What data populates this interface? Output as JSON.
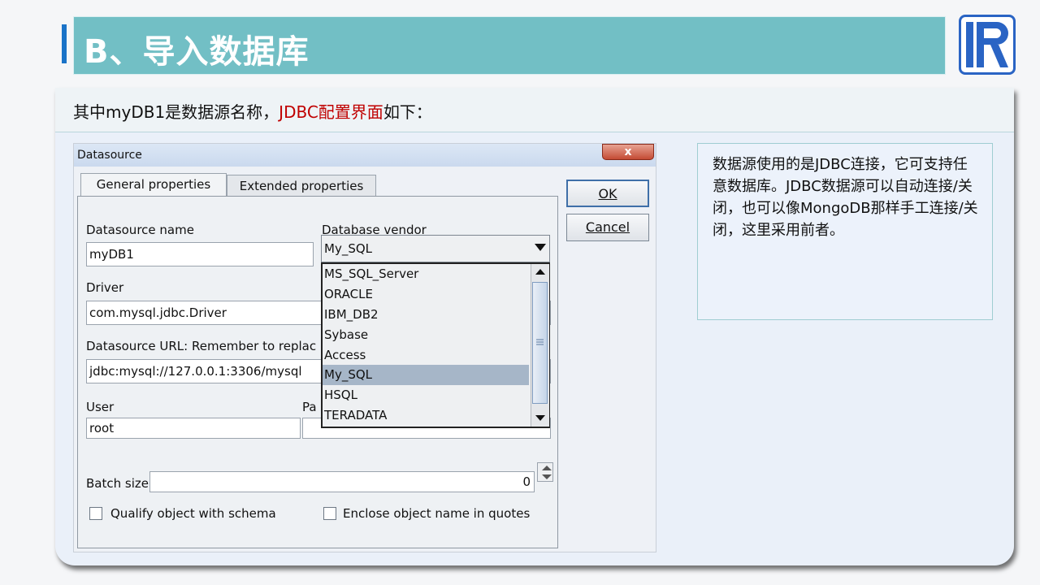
{
  "slide": {
    "title": "B、导入数据库",
    "subtitle_prefix": "其中myDB1是数据源名称，",
    "subtitle_highlight": "JDBC配置界面",
    "subtitle_suffix": "如下：",
    "note": "数据源使用的是JDBC连接，它可支持任意数据库。JDBC数据源可以自动连接/关闭，也可以像MongoDB那样手工连接/关闭，这里采用前者。"
  },
  "dialog": {
    "title": "Datasource",
    "close_label": "x",
    "tabs": [
      {
        "label": "General properties"
      },
      {
        "label": "Extended properties"
      }
    ],
    "fields": {
      "datasource_name_label": "Datasource name",
      "datasource_name_value": "myDB1",
      "vendor_label": "Database vendor",
      "vendor_selected": "My_SQL",
      "driver_label": "Driver",
      "driver_value": "com.mysql.jdbc.Driver",
      "url_label": "Datasource URL: Remember to replac",
      "url_value": "jdbc:mysql://127.0.0.1:3306/mysql",
      "user_label": "User",
      "user_value": "root",
      "password_label": "Pa",
      "batch_label": "Batch size",
      "batch_value": "0"
    },
    "vendor_options": [
      "MS_SQL_Server",
      "ORACLE",
      "IBM_DB2",
      "Sybase",
      "Access",
      "My_SQL",
      "HSQL",
      "TERADATA"
    ],
    "checkboxes": {
      "qualify": "Qualify object with schema",
      "enclose": "Enclose object name in quotes"
    },
    "buttons": {
      "ok": "OK",
      "cancel": "Cancel"
    }
  },
  "colors": {
    "title_bar": "#72bfc5",
    "accent": "#1a73c8",
    "highlight": "#c00000",
    "selected_option": "#a6b6c8"
  }
}
